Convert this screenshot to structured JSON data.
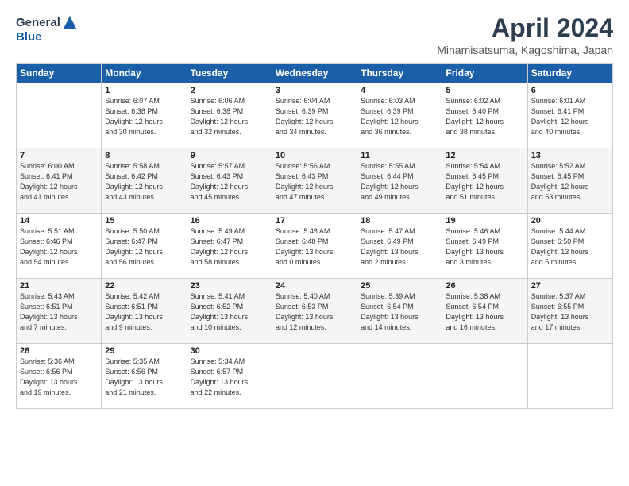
{
  "logo": {
    "general": "General",
    "blue": "Blue"
  },
  "title": "April 2024",
  "location": "Minamisatsuma, Kagoshima, Japan",
  "headers": [
    "Sunday",
    "Monday",
    "Tuesday",
    "Wednesday",
    "Thursday",
    "Friday",
    "Saturday"
  ],
  "weeks": [
    [
      {
        "day": "",
        "info": ""
      },
      {
        "day": "1",
        "info": "Sunrise: 6:07 AM\nSunset: 6:38 PM\nDaylight: 12 hours\nand 30 minutes."
      },
      {
        "day": "2",
        "info": "Sunrise: 6:06 AM\nSunset: 6:38 PM\nDaylight: 12 hours\nand 32 minutes."
      },
      {
        "day": "3",
        "info": "Sunrise: 6:04 AM\nSunset: 6:39 PM\nDaylight: 12 hours\nand 34 minutes."
      },
      {
        "day": "4",
        "info": "Sunrise: 6:03 AM\nSunset: 6:39 PM\nDaylight: 12 hours\nand 36 minutes."
      },
      {
        "day": "5",
        "info": "Sunrise: 6:02 AM\nSunset: 6:40 PM\nDaylight: 12 hours\nand 38 minutes."
      },
      {
        "day": "6",
        "info": "Sunrise: 6:01 AM\nSunset: 6:41 PM\nDaylight: 12 hours\nand 40 minutes."
      }
    ],
    [
      {
        "day": "7",
        "info": "Sunrise: 6:00 AM\nSunset: 6:41 PM\nDaylight: 12 hours\nand 41 minutes."
      },
      {
        "day": "8",
        "info": "Sunrise: 5:58 AM\nSunset: 6:42 PM\nDaylight: 12 hours\nand 43 minutes."
      },
      {
        "day": "9",
        "info": "Sunrise: 5:57 AM\nSunset: 6:43 PM\nDaylight: 12 hours\nand 45 minutes."
      },
      {
        "day": "10",
        "info": "Sunrise: 5:56 AM\nSunset: 6:43 PM\nDaylight: 12 hours\nand 47 minutes."
      },
      {
        "day": "11",
        "info": "Sunrise: 5:55 AM\nSunset: 6:44 PM\nDaylight: 12 hours\nand 49 minutes."
      },
      {
        "day": "12",
        "info": "Sunrise: 5:54 AM\nSunset: 6:45 PM\nDaylight: 12 hours\nand 51 minutes."
      },
      {
        "day": "13",
        "info": "Sunrise: 5:52 AM\nSunset: 6:45 PM\nDaylight: 12 hours\nand 53 minutes."
      }
    ],
    [
      {
        "day": "14",
        "info": "Sunrise: 5:51 AM\nSunset: 6:46 PM\nDaylight: 12 hours\nand 54 minutes."
      },
      {
        "day": "15",
        "info": "Sunrise: 5:50 AM\nSunset: 6:47 PM\nDaylight: 12 hours\nand 56 minutes."
      },
      {
        "day": "16",
        "info": "Sunrise: 5:49 AM\nSunset: 6:47 PM\nDaylight: 12 hours\nand 58 minutes."
      },
      {
        "day": "17",
        "info": "Sunrise: 5:48 AM\nSunset: 6:48 PM\nDaylight: 13 hours\nand 0 minutes."
      },
      {
        "day": "18",
        "info": "Sunrise: 5:47 AM\nSunset: 6:49 PM\nDaylight: 13 hours\nand 2 minutes."
      },
      {
        "day": "19",
        "info": "Sunrise: 5:46 AM\nSunset: 6:49 PM\nDaylight: 13 hours\nand 3 minutes."
      },
      {
        "day": "20",
        "info": "Sunrise: 5:44 AM\nSunset: 6:50 PM\nDaylight: 13 hours\nand 5 minutes."
      }
    ],
    [
      {
        "day": "21",
        "info": "Sunrise: 5:43 AM\nSunset: 6:51 PM\nDaylight: 13 hours\nand 7 minutes."
      },
      {
        "day": "22",
        "info": "Sunrise: 5:42 AM\nSunset: 6:51 PM\nDaylight: 13 hours\nand 9 minutes."
      },
      {
        "day": "23",
        "info": "Sunrise: 5:41 AM\nSunset: 6:52 PM\nDaylight: 13 hours\nand 10 minutes."
      },
      {
        "day": "24",
        "info": "Sunrise: 5:40 AM\nSunset: 6:53 PM\nDaylight: 13 hours\nand 12 minutes."
      },
      {
        "day": "25",
        "info": "Sunrise: 5:39 AM\nSunset: 6:54 PM\nDaylight: 13 hours\nand 14 minutes."
      },
      {
        "day": "26",
        "info": "Sunrise: 5:38 AM\nSunset: 6:54 PM\nDaylight: 13 hours\nand 16 minutes."
      },
      {
        "day": "27",
        "info": "Sunrise: 5:37 AM\nSunset: 6:55 PM\nDaylight: 13 hours\nand 17 minutes."
      }
    ],
    [
      {
        "day": "28",
        "info": "Sunrise: 5:36 AM\nSunset: 6:56 PM\nDaylight: 13 hours\nand 19 minutes."
      },
      {
        "day": "29",
        "info": "Sunrise: 5:35 AM\nSunset: 6:56 PM\nDaylight: 13 hours\nand 21 minutes."
      },
      {
        "day": "30",
        "info": "Sunrise: 5:34 AM\nSunset: 6:57 PM\nDaylight: 13 hours\nand 22 minutes."
      },
      {
        "day": "",
        "info": ""
      },
      {
        "day": "",
        "info": ""
      },
      {
        "day": "",
        "info": ""
      },
      {
        "day": "",
        "info": ""
      }
    ]
  ]
}
